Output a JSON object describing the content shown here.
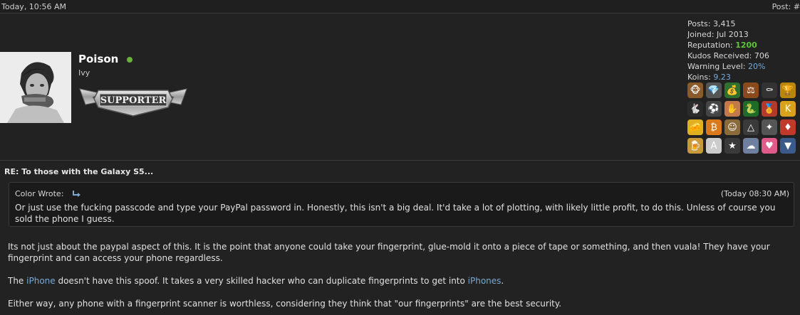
{
  "header": {
    "date": "Today, 10:56 AM",
    "post_label": "Post: #"
  },
  "user": {
    "name": "Poison",
    "title": "Ivy",
    "badge_text": "SUPPORTER",
    "online_color": "#6cb23a"
  },
  "stats": {
    "posts_label": "Posts:",
    "posts": "3,415",
    "joined_label": "Joined:",
    "joined": "Jul 2013",
    "rep_label": "Reputation:",
    "rep": "1200",
    "kudos_label": "Kudos Received:",
    "kudos": "706",
    "warning_label": "Warning Level:",
    "warning": "20%",
    "koins_label": "Koins:",
    "koins": "9.23"
  },
  "awards": [
    {
      "icon": "monkey-icon",
      "glyph": "🐵",
      "bg": "#8a5a2b"
    },
    {
      "icon": "diamond-icon",
      "glyph": "💎",
      "bg": "#555555"
    },
    {
      "icon": "money-bag-icon",
      "glyph": "💰",
      "bg": "#2f6f2f"
    },
    {
      "icon": "gavel-icon",
      "glyph": "⚖",
      "bg": "#8b4a1c"
    },
    {
      "icon": "coffin-icon",
      "glyph": "⚰",
      "bg": "#333333"
    },
    {
      "icon": "trophy-icon",
      "glyph": "🏆",
      "bg": "#b8860b"
    },
    {
      "icon": "bunny-icon",
      "glyph": "🐇",
      "bg": "#2a2a2a"
    },
    {
      "icon": "soccer-ball-icon",
      "glyph": "⚽",
      "bg": "#444444"
    },
    {
      "icon": "hand-sign-icon",
      "glyph": "✋",
      "bg": "#c27a4a"
    },
    {
      "icon": "snake-icon",
      "glyph": "🐍",
      "bg": "#1e6b2a"
    },
    {
      "icon": "medal-icon",
      "glyph": "🏅",
      "bg": "#b33a2a"
    },
    {
      "icon": "k-badge-icon",
      "glyph": "K",
      "bg": "#d9a21b"
    },
    {
      "icon": "cheese-icon",
      "glyph": "🧀",
      "bg": "#e0b020"
    },
    {
      "icon": "coin-icon",
      "glyph": "₿",
      "bg": "#d9791b"
    },
    {
      "icon": "kid-icon",
      "glyph": "☺",
      "bg": "#8b6b3a"
    },
    {
      "icon": "eye-pyramid-icon",
      "glyph": "△",
      "bg": "#3a3a3a"
    },
    {
      "icon": "shuriken-icon",
      "glyph": "✦",
      "bg": "#555555"
    },
    {
      "icon": "ruby-icon",
      "glyph": "♦",
      "bg": "#c0392b"
    },
    {
      "icon": "cup-icon",
      "glyph": "🍺",
      "bg": "#c89a3a"
    },
    {
      "icon": "certificate-icon",
      "glyph": "A",
      "bg": "#cccccc"
    },
    {
      "icon": "star-icon",
      "glyph": "★",
      "bg": "#3a3a3a"
    },
    {
      "icon": "cloud-icon",
      "glyph": "☁",
      "bg": "#6f7f9f"
    },
    {
      "icon": "heart-icon",
      "glyph": "♥",
      "bg": "#e05a8a"
    },
    {
      "icon": "wings-icon",
      "glyph": "▼",
      "bg": "#3a5a8a"
    }
  ],
  "post": {
    "subject": "RE: To those with the Galaxy S5...",
    "quote_author": "Color Wrote:",
    "quote_time": "(Today 08:30 AM)",
    "quote_text": "Or just use the fucking passcode and type your PayPal password in. Honestly, this isn't a big deal. It'd take a lot of plotting, with likely little profit, to do this. Unless of course you sold the phone I guess.",
    "p1": "Its not just about the paypal aspect of this. It is the point that anyone could take your fingerprint, glue-mold it onto a piece of tape or something, and then vuala! They have your fingerprint and can access your phone regardless.",
    "p2_a": "The ",
    "p2_link1": "iPhone",
    "p2_b": " doesn't have this spoof. It takes a very skilled hacker who can duplicate fingerprints to get into ",
    "p2_link2": "iPhones",
    "p2_c": ".",
    "p3": "Either way, any phone with a fingerprint scanner is worthless, considering they think that \"our fingerprints\" are the best security."
  }
}
